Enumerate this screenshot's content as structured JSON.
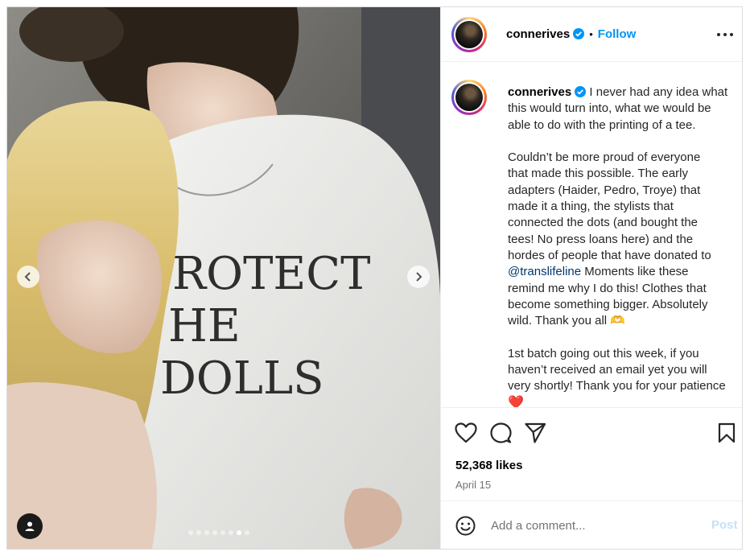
{
  "post": {
    "username": "connerives",
    "follow_label": "Follow",
    "separator": "•",
    "caption_lines": [
      "I never had any idea what",
      "this would turn into, what we would be",
      "able to do with the printing of a tee.",
      "",
      "Couldn’t be more proud of everyone",
      "that made this possible. The early",
      "adapters (Haider, Pedro, Troye) that",
      "made it a thing, the stylists that",
      "connected the dots (and bought the",
      "tees! No press loans here) and the",
      "hordes of people that have donated to"
    ],
    "mention": "@translifeline",
    "caption_after_mention_lines": [
      " Moments like these",
      "remind me why I do this! Clothes that",
      "become something bigger. Absolutely",
      "wild. Thank you all 🫶",
      "",
      "1st batch going out this week, if you",
      "haven’t received an email yet you will",
      "very shortly! Thank you for your patience"
    ],
    "caption_emoji": "❤️",
    "likes": "52,368 likes",
    "date": "April 15"
  },
  "photo": {
    "shirt_text": [
      "ROTECT",
      "HE",
      "DOLLS"
    ],
    "carousel_count": 8,
    "carousel_active": 6
  },
  "comment": {
    "placeholder": "Add a comment...",
    "post_label": "Post"
  },
  "icons": {
    "verified": "verified-badge-icon",
    "more": "more-options-icon",
    "like": "heart-icon",
    "comment": "comment-icon",
    "share": "share-icon",
    "save": "bookmark-icon",
    "emoji": "emoji-icon",
    "tag": "user-tag-icon",
    "prev": "chevron-left-icon",
    "next": "chevron-right-icon"
  },
  "colors": {
    "accent": "#0095f6",
    "mention": "#00376b",
    "muted": "#737373",
    "post_disabled": "#c5e1fc",
    "border": "#dbdbdb"
  }
}
